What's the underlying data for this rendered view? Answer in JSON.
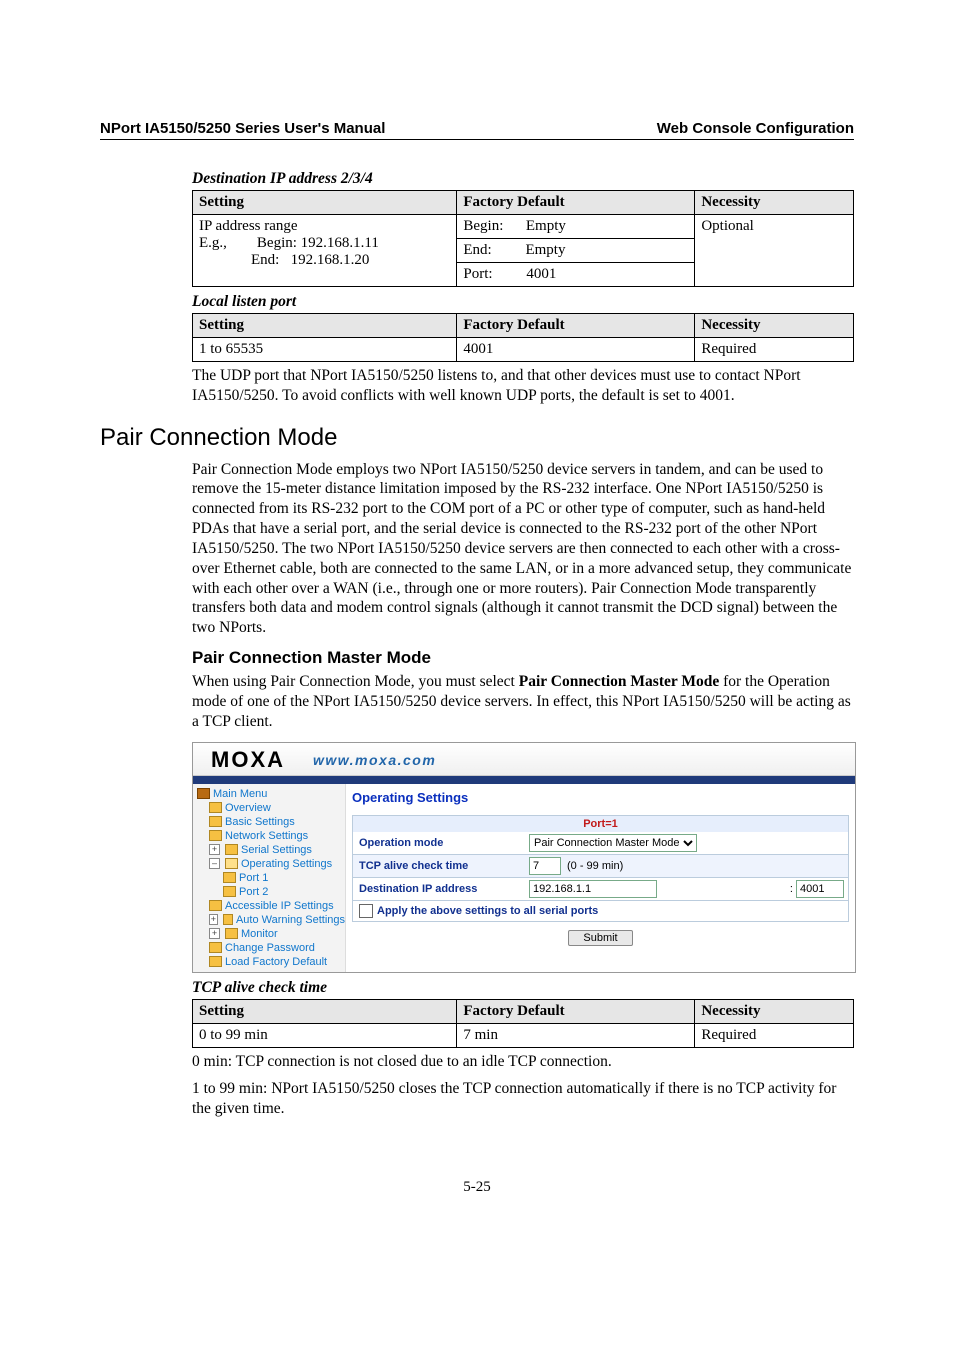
{
  "header": {
    "left": "NPort IA5150/5250 Series User's Manual",
    "right": "Web Console Configuration"
  },
  "page_number": "5-25",
  "table1": {
    "caption": "Destination IP address 2/3/4",
    "h_setting": "Setting",
    "h_default": "Factory Default",
    "h_necessity": "Necessity",
    "c1_l1": "IP address range",
    "c1_l2a": "E.g.,",
    "c1_l2b": "Begin: 192.168.1.11",
    "c1_l3": "End:   192.168.1.20",
    "c2_l1": "Begin:      Empty",
    "c2_l2": "End:         Empty",
    "c2_l3": "Port:         4001",
    "c3": "Optional"
  },
  "table2": {
    "caption": "Local listen port",
    "h_setting": "Setting",
    "h_default": "Factory Default",
    "h_necessity": "Necessity",
    "r1c1": "1 to 65535",
    "r1c2": "4001",
    "r1c3": "Required",
    "note": "The UDP port that NPort IA5150/5250 listens to, and that other devices must use to contact NPort IA5150/5250. To avoid conflicts with well known UDP ports, the default is set to 4001."
  },
  "section": {
    "title": "Pair Connection Mode",
    "body": "Pair Connection Mode employs two NPort IA5150/5250 device servers in tandem, and can be used to remove the 15-meter distance limitation imposed by the RS-232 interface. One NPort IA5150/5250 is connected from its RS-232 port to the COM port of a PC or other type of computer, such as hand-held PDAs that have a serial port, and the serial device is connected to the RS-232 port of the other NPort IA5150/5250. The two NPort IA5150/5250 device servers are then connected to each other with a cross-over Ethernet cable, both are connected to the same LAN, or in a more advanced setup, they communicate with each other over a WAN (i.e., through one or more routers). Pair Connection Mode transparently transfers both data and modem control signals (although it cannot transmit the DCD signal) between the two NPorts."
  },
  "subsection": {
    "title": "Pair Connection Master Mode",
    "intro_a": "When using Pair Connection Mode, you must select ",
    "intro_bold": "Pair Connection Master Mode",
    "intro_b": " for the Operation mode of one of the NPort IA5150/5250 device servers. In effect, this NPort IA5150/5250 will be acting as a TCP client."
  },
  "shot": {
    "logo": "MOXA",
    "url": "www.moxa.com",
    "nav": {
      "main": "Main Menu",
      "overview": "Overview",
      "basic": "Basic Settings",
      "network": "Network Settings",
      "serial": "Serial Settings",
      "operating": "Operating Settings",
      "port1": "Port 1",
      "port2": "Port 2",
      "accessible": "Accessible IP Settings",
      "autowarn": "Auto Warning Settings",
      "monitor": "Monitor",
      "changepw": "Change Password",
      "loadfac": "Load Factory Default"
    },
    "panel": {
      "title": "Operating Settings",
      "port": "Port=1",
      "l_opmode": "Operation mode",
      "v_opmode": "Pair Connection Master Mode",
      "l_tcp": "TCP alive check time",
      "v_tcp": "7",
      "v_tcp_hint": "(0 - 99 min)",
      "l_dest": "Destination IP address",
      "v_dest": "192.168.1.1",
      "v_destport": "4001",
      "v_destsep": ":",
      "apply": "Apply the above settings to all serial ports",
      "submit": "Submit"
    }
  },
  "table3": {
    "caption": "TCP alive check time",
    "h_setting": "Setting",
    "h_default": "Factory Default",
    "h_necessity": "Necessity",
    "r1c1": "0 to 99 min",
    "r1c2": "7 min",
    "r1c3": "Required",
    "note1": "0 min: TCP connection is not closed due to an idle TCP connection.",
    "note2": "1 to 99 min: NPort IA5150/5250 closes the TCP connection automatically if there is no TCP activity for the given time."
  }
}
